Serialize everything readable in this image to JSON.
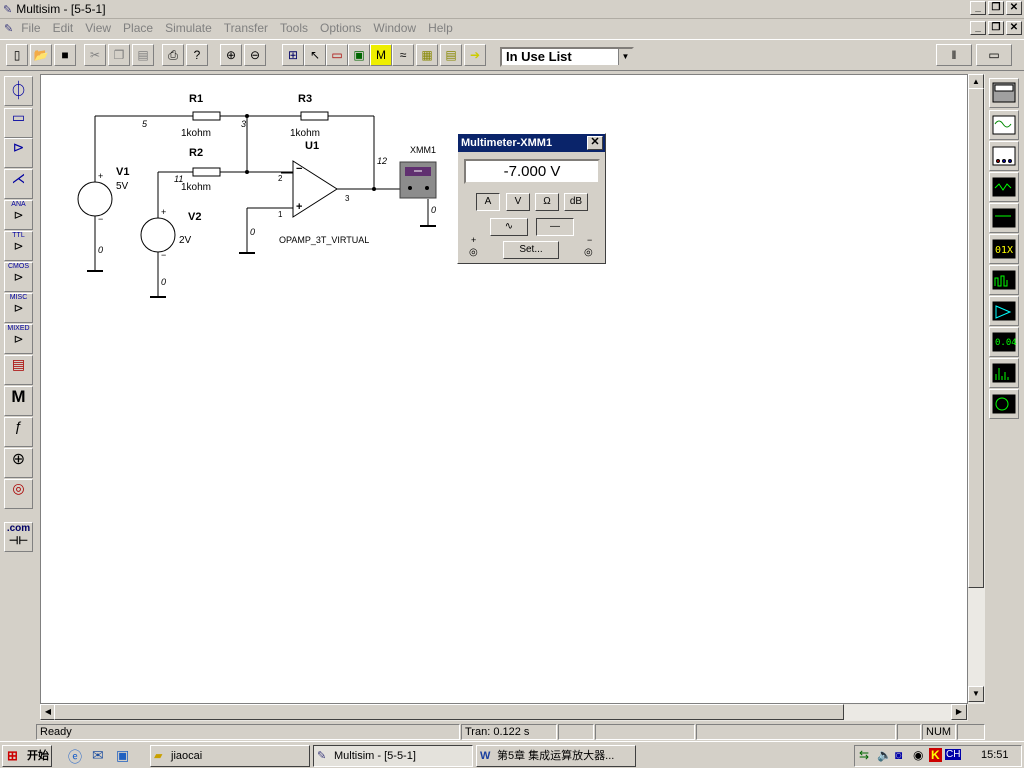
{
  "window": {
    "title": "Multisim - [5-5-1]"
  },
  "menu": [
    "File",
    "Edit",
    "View",
    "Place",
    "Simulate",
    "Transfer",
    "Tools",
    "Options",
    "Window",
    "Help"
  ],
  "toolbar": {
    "list_select": "In Use List"
  },
  "left_toolbar": [
    "ANA",
    "TTL",
    "CMOS",
    "MISC",
    "MIXED",
    "M",
    ".com"
  ],
  "circuit": {
    "components": {
      "r1": {
        "name": "R1",
        "value": "1kohm"
      },
      "r2": {
        "name": "R2",
        "value": "1kohm"
      },
      "r3": {
        "name": "R3",
        "value": "1kohm"
      },
      "v1": {
        "name": "V1",
        "value": "5V"
      },
      "v2": {
        "name": "V2",
        "value": "2V"
      },
      "u1": {
        "name": "U1",
        "model": "OPAMP_3T_VIRTUAL"
      },
      "xmm1": {
        "name": "XMM1"
      }
    },
    "nodes": [
      "5",
      "3",
      "11",
      "2",
      "1",
      "3",
      "12",
      "0",
      "0",
      "0",
      "0"
    ],
    "polarity": {
      "plus": "+",
      "minus": "−"
    }
  },
  "multimeter": {
    "title": "Multimeter-XMM1",
    "reading": "-7.000  V",
    "mode_buttons": [
      "A",
      "V",
      "Ω",
      "dB"
    ],
    "set_button": "Set...",
    "terminal_plus": "+",
    "terminal_minus": "−"
  },
  "status": {
    "state": "Ready",
    "tran": "Tran: 0.122 s",
    "num": "NUM"
  },
  "taskbar": {
    "start": "开始",
    "tasks": [
      "jiaocai",
      "Multisim - [5-5-1]",
      "第5章  集成运算放大器..."
    ],
    "tray_items": [
      "CH"
    ],
    "clock": "15:51"
  }
}
